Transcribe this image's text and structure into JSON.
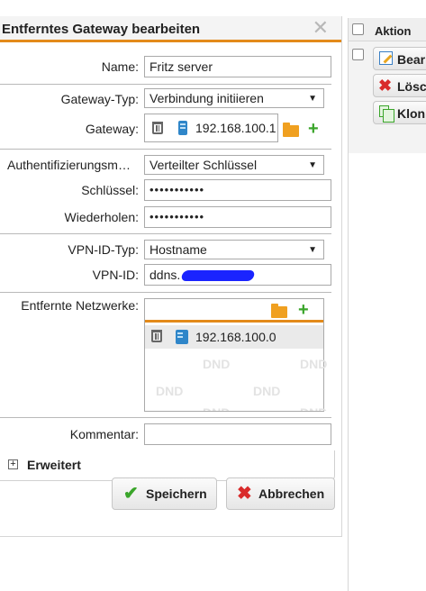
{
  "dialog": {
    "title": "Entferntes Gateway bearbeiten",
    "close_icon": "close-icon"
  },
  "form": {
    "name_label": "Name:",
    "name_value": "Fritz server",
    "gateway_type_label": "Gateway-Typ:",
    "gateway_type_value": "Verbindung initiieren",
    "gateway_label": "Gateway:",
    "gateway_value": "192.168.100.1",
    "auth_label": "Authentifizierungsm…",
    "auth_value": "Verteilter Schlüssel",
    "key_label": "Schlüssel:",
    "key_value": "•••••••••••",
    "repeat_label": "Wiederholen:",
    "repeat_value": "•••••••••••",
    "vpn_id_type_label": "VPN-ID-Typ:",
    "vpn_id_type_value": "Hostname",
    "vpn_id_label": "VPN-ID:",
    "vpn_id_value": "ddns.",
    "remote_networks_label": "Entfernte Netzwerke:",
    "remote_networks": [
      "192.168.100.0"
    ],
    "dnd_text": "DND",
    "comment_label": "Kommentar:",
    "comment_value": ""
  },
  "advanced": {
    "expand_symbol": "+",
    "label": "Erweitert"
  },
  "buttons": {
    "save": "Speichern",
    "cancel": "Abbrechen"
  },
  "panel": {
    "header": "Aktion",
    "actions": [
      "Bear",
      "Lösc",
      "Klon"
    ]
  },
  "colors": {
    "accent": "#e38a1a",
    "add_green": "#3aa52a",
    "delete_red": "#d92b2b",
    "device_blue": "#2f86c9"
  }
}
